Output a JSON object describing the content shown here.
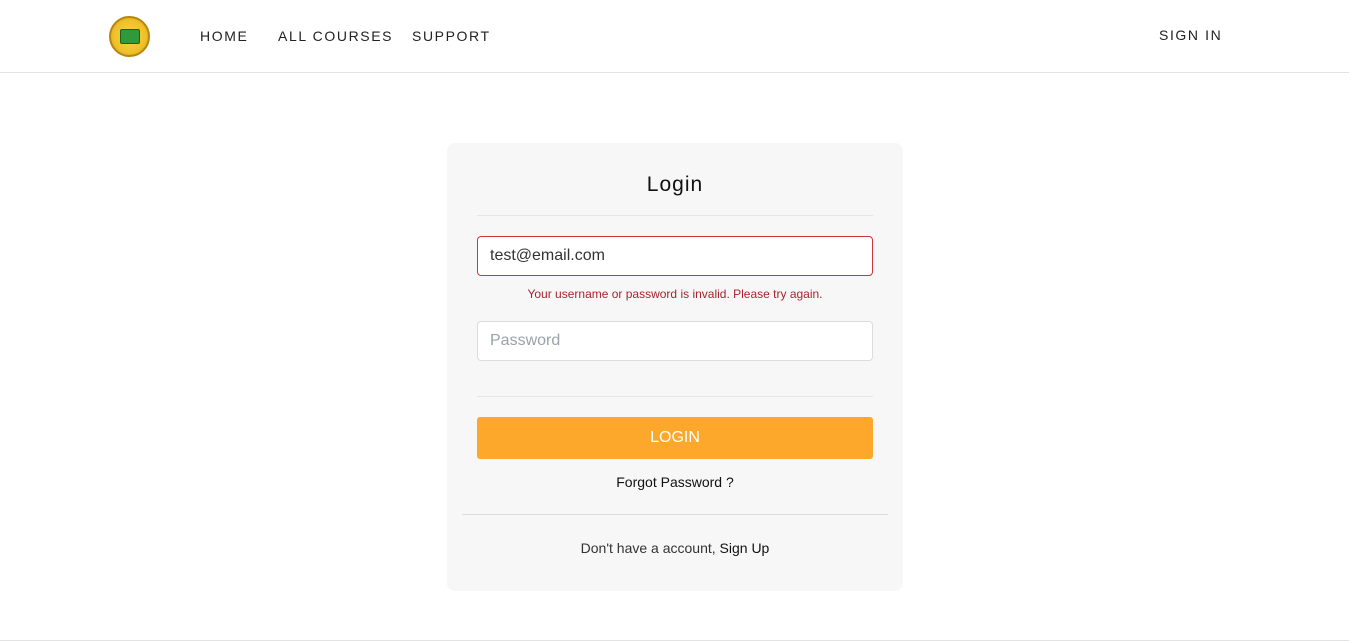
{
  "nav": {
    "home": "HOME",
    "all_courses": "ALL COURSES",
    "support": "SUPPORT",
    "sign_in": "SIGN IN"
  },
  "login_form": {
    "title": "Login",
    "email_value": "test@email.com",
    "error_message": "Your username or password is invalid. Please try again.",
    "password_placeholder": "Password",
    "login_button": "LOGIN",
    "forgot_password": "Forgot Password ?",
    "no_account_text": "Don't have a account,",
    "sign_up_link": "Sign Up"
  },
  "colors": {
    "accent": "#fda72b",
    "error": "#d0343f",
    "card_bg": "#f7f7f7"
  }
}
